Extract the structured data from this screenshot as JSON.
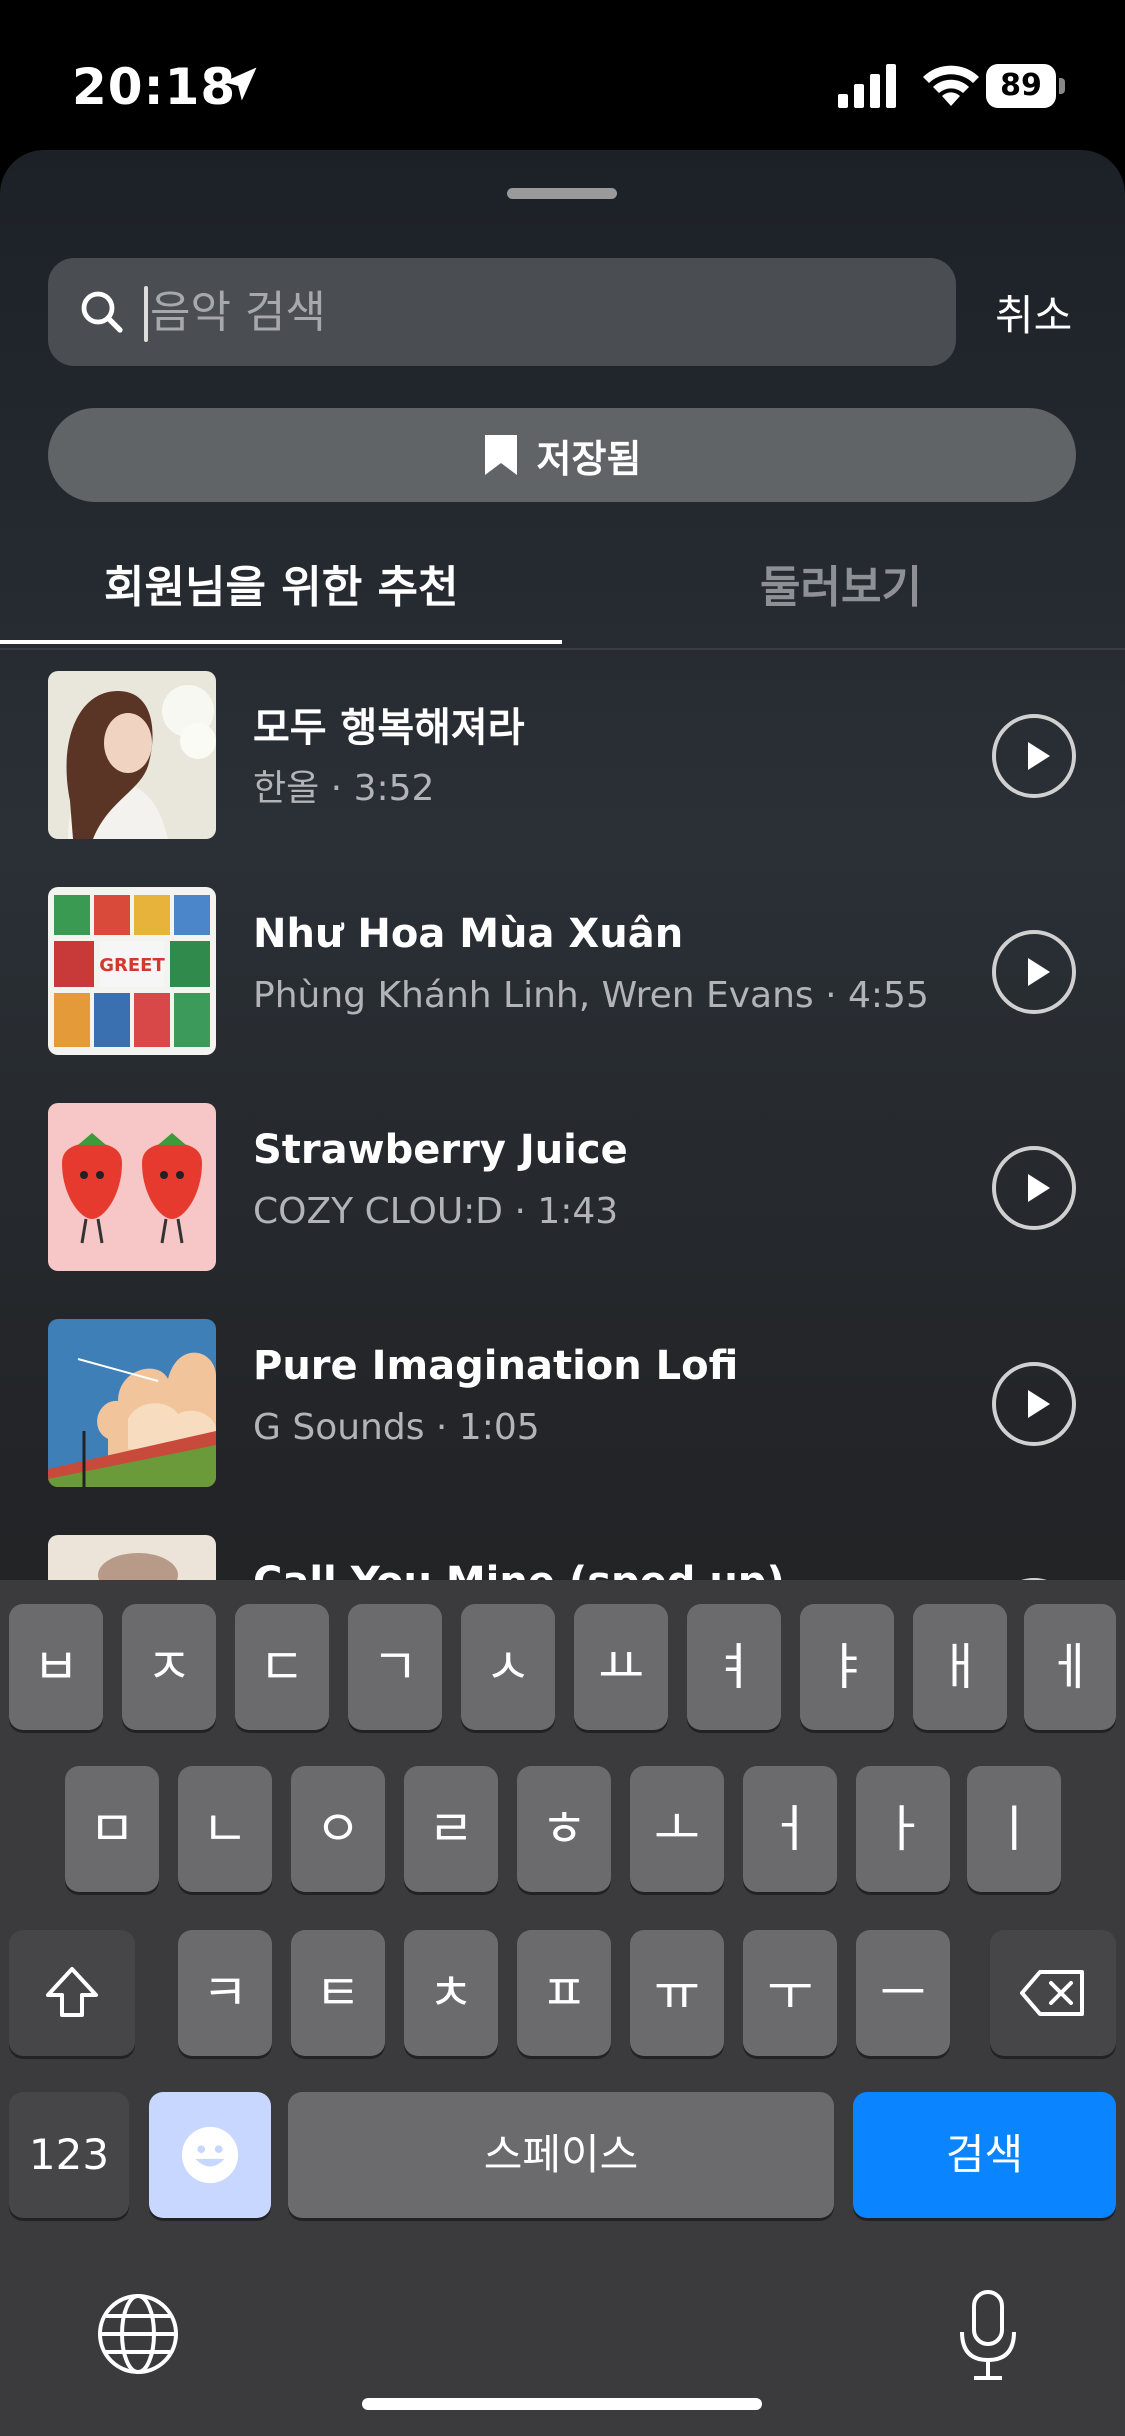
{
  "status_bar": {
    "time": "20:18",
    "battery": "89"
  },
  "search": {
    "placeholder": "음악 검색",
    "value": "",
    "cancel_label": "취소"
  },
  "saved_button": {
    "label": "저장됨"
  },
  "tabs": [
    {
      "label": "회원님을 위한 추천",
      "active": true
    },
    {
      "label": "둘러보기",
      "active": false
    }
  ],
  "tracks": [
    {
      "title": "모두 행복해져라",
      "meta": "한올 · 3:52"
    },
    {
      "title": "Như Hoa Mùa Xuân",
      "meta": "Phùng Khánh Linh, Wren Evans · 4:55"
    },
    {
      "title": "Strawberry Juice",
      "meta": "COZY CLOU:D · 1:43"
    },
    {
      "title": "Pure Imagination Lofi",
      "meta": "G Sounds · 1:05"
    },
    {
      "title": "Call You Mine (sped up)",
      "meta": ""
    }
  ],
  "keyboard": {
    "row1": [
      "ㅂ",
      "ㅈ",
      "ㄷ",
      "ㄱ",
      "ㅅ",
      "ㅛ",
      "ㅕ",
      "ㅑ",
      "ㅐ",
      "ㅔ"
    ],
    "row2": [
      "ㅁ",
      "ㄴ",
      "ㅇ",
      "ㄹ",
      "ㅎ",
      "ㅗ",
      "ㅓ",
      "ㅏ",
      "ㅣ"
    ],
    "row3": [
      "ㅋ",
      "ㅌ",
      "ㅊ",
      "ㅍ",
      "ㅠ",
      "ㅜ",
      "ㅡ"
    ],
    "numbers_label": "123",
    "space_label": "스페이스",
    "search_label": "검색"
  },
  "colors": {
    "accent": "#0a84ff",
    "sheet_bg": "#24282d"
  }
}
